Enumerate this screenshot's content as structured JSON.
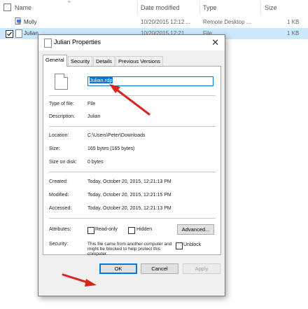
{
  "explorer": {
    "columns": {
      "name": "Name",
      "date_modified": "Date modified",
      "type": "Type",
      "size": "Size"
    },
    "rows": [
      {
        "name": "Molly",
        "date": "10/20/2015 12:12 ...",
        "type": "Remote Desktop ...",
        "size": "1 KB",
        "selected": false
      },
      {
        "name": "Julian",
        "date": "10/20/2015 12:21 ...",
        "type": "File",
        "size": "1 KB",
        "selected": true
      }
    ]
  },
  "dialog": {
    "title": "Julian Properties",
    "tabs": [
      "General",
      "Security",
      "Details",
      "Previous Versions"
    ],
    "active_tab": "General",
    "filename_value": "Julian.rdp",
    "fields": {
      "type_label": "Type of file:",
      "type_value": "File",
      "description_label": "Description:",
      "description_value": "Julian",
      "location_label": "Location:",
      "location_value": "C:\\Users\\Peter\\Downloads",
      "size_label": "Size:",
      "size_value": "165 bytes (165 bytes)",
      "size_on_disk_label": "Size on disk:",
      "size_on_disk_value": "0 bytes",
      "created_label": "Created:",
      "created_value": "Today, October 20, 2015, 12:21:13 PM",
      "modified_label": "Modified:",
      "modified_value": "Today, October 20, 2015, 12:21:15 PM",
      "accessed_label": "Accessed:",
      "accessed_value": "Today, October 20, 2015, 12:21:13 PM",
      "attributes_label": "Attributes:",
      "readonly_label": "Read-only",
      "hidden_label": "Hidden",
      "advanced_label": "Advanced...",
      "security_label": "Security:",
      "security_text": "This file came from another computer and might be blocked to help protect this computer.",
      "unblock_label": "Unblock"
    },
    "buttons": {
      "ok": "OK",
      "cancel": "Cancel",
      "apply": "Apply"
    },
    "annotation_color": "#d9261c"
  }
}
